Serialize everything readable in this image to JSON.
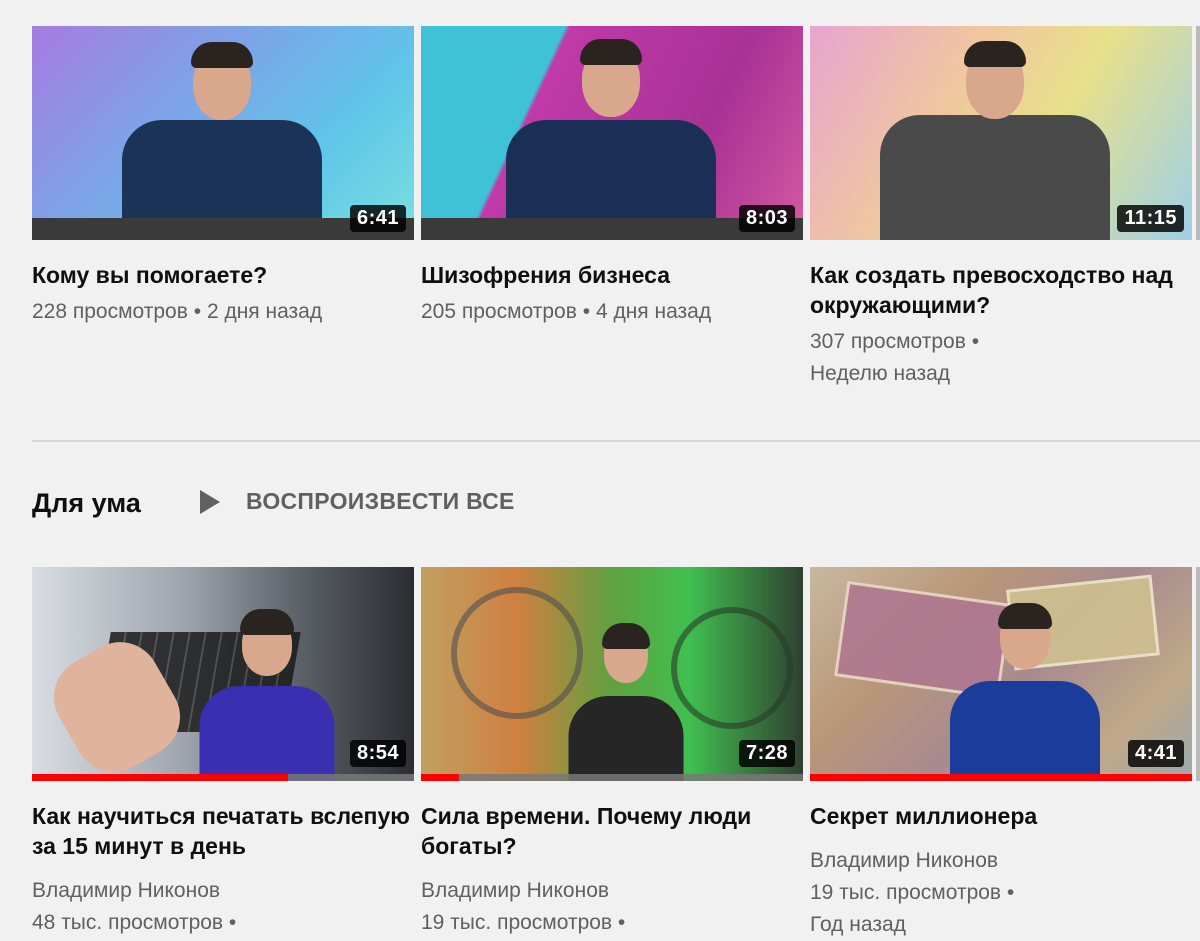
{
  "top_videos": [
    {
      "title": "Кому вы помогаете?",
      "views": "228 просмотров",
      "age": "2 дня назад",
      "duration": "6:41"
    },
    {
      "title": "Шизофрения бизнеса",
      "views": "205 просмотров",
      "age": "4 дня назад",
      "duration": "8:03"
    },
    {
      "title": "Как создать превосходство над окружающими?",
      "views": "307 просмотров •",
      "age": "Неделю назад",
      "duration": "11:15"
    }
  ],
  "shelf": {
    "title": "Для ума",
    "play_all": "ВОСПРОИЗВЕСТИ ВСЕ"
  },
  "shelf_videos": [
    {
      "title": "Как научиться печатать вслепую за 15 минут в день",
      "channel": "Владимир Никонов",
      "views": "48 тыс. просмотров •",
      "duration": "8:54",
      "progress": 0.67
    },
    {
      "title": "Сила времени. Почему люди богаты?",
      "channel": "Владимир Никонов",
      "views": "19 тыс. просмотров •",
      "duration": "7:28",
      "progress": 0.1
    },
    {
      "title": "Секрет миллионера",
      "channel": "Владимир Никонов",
      "views": "19 тыс. просмотров •",
      "age": "Год назад",
      "duration": "4:41",
      "progress": 1.0
    }
  ],
  "separator": "•"
}
